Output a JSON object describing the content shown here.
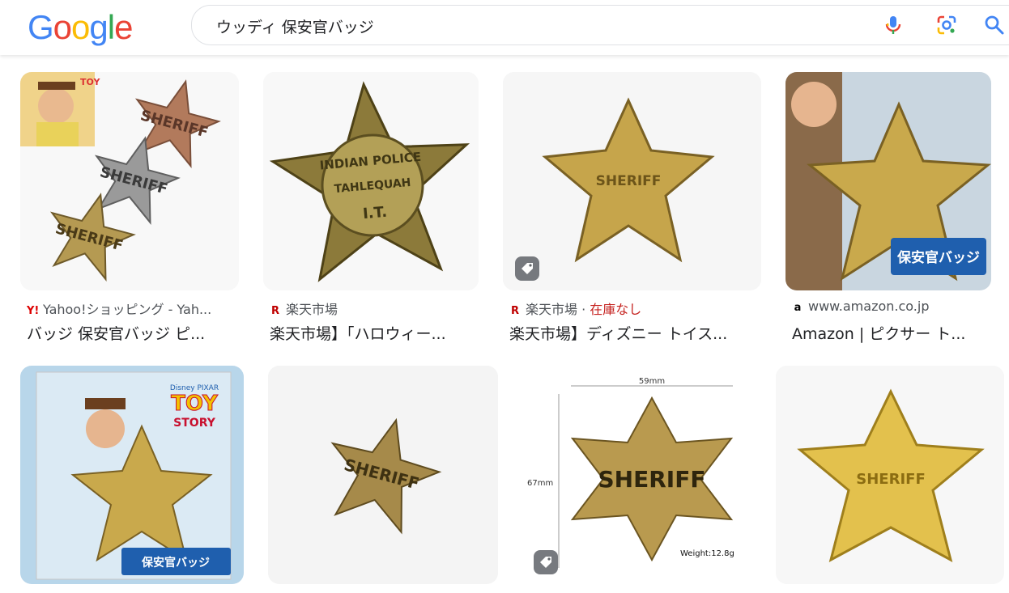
{
  "header": {
    "logo_letters": [
      {
        "ch": "G",
        "color": "#4285F4"
      },
      {
        "ch": "o",
        "color": "#EA4335"
      },
      {
        "ch": "o",
        "color": "#FBBC05"
      },
      {
        "ch": "g",
        "color": "#4285F4"
      },
      {
        "ch": "l",
        "color": "#34A853"
      },
      {
        "ch": "e",
        "color": "#EA4335"
      }
    ],
    "search_query": "ウッディ 保安官バッジ"
  },
  "results_row1": [
    {
      "favicon": "Y!",
      "source": "Yahoo!ショッピング - Yah...",
      "stock": "",
      "title": "バッジ 保安官バッジ ピ...",
      "has_tag": false
    },
    {
      "favicon": "R",
      "source": "楽天市場",
      "stock": "",
      "title": "楽天市場】「ハロウィー...",
      "has_tag": false
    },
    {
      "favicon": "R",
      "source": "楽天市場 · ",
      "stock": "在庫なし",
      "title": "楽天市場】ディズニー トイス...",
      "has_tag": true
    },
    {
      "favicon": "a",
      "source": "www.amazon.co.jp",
      "stock": "",
      "title": "Amazon | ピクサー ト...",
      "has_tag": false
    }
  ],
  "results_row2": [
    {
      "has_tag": false
    },
    {
      "has_tag": false
    },
    {
      "has_tag": true
    },
    {
      "has_tag": false
    }
  ],
  "image_text": {
    "sheriff": "SHERIFF",
    "indian_police": "INDIAN POLICE",
    "tahlequah": "TAHLEQUAH",
    "it": "I.T.",
    "toy": "TOY",
    "story": "STORY",
    "hoankan_badge": "保安官バッジ",
    "dim_width": "59mm",
    "dim_height": "67mm",
    "weight": "Weight:12.8g",
    "disney_pixar": "Disney PIXAR"
  },
  "colors": {
    "brass": "#b59a52",
    "gold": "#e2c255",
    "silver": "#9a9a9a",
    "copper": "#b27a5c"
  }
}
